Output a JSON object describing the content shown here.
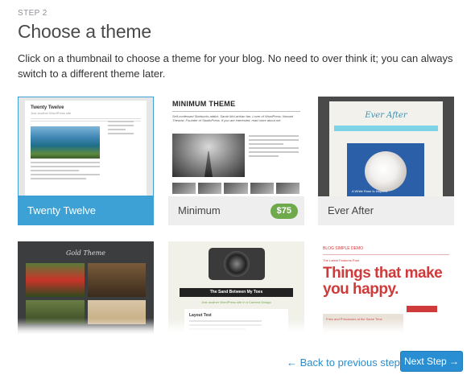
{
  "header": {
    "step": "STEP 2",
    "title": "Choose a theme",
    "description": "Click on a thumbnail to choose a theme for your blog. No need to over think it; you can always switch to a different theme later."
  },
  "themes": [
    {
      "name": "Twenty Twelve",
      "selected": true,
      "price": null,
      "preview_title": "Twenty Twelve",
      "preview_tagline": "Just another WordPress site"
    },
    {
      "name": "Minimum",
      "selected": false,
      "price": "$75",
      "preview_title": "MINIMUM THEME",
      "preview_intro": "Self-confessed Starbucks addict. Sarah McLachlan fan. Lover of WordPress. Nomad Theorist. Founder of StudioPress. If you are interested, read more about me."
    },
    {
      "name": "Ever After",
      "selected": false,
      "price": null,
      "preview_title": "Ever After",
      "preview_caption": "A White Rose Is Inspired"
    },
    {
      "name": "",
      "selected": false,
      "price": null,
      "preview_title": "Gold Theme"
    },
    {
      "name": "",
      "selected": false,
      "price": null,
      "preview_title": "The Sand Between My Toes",
      "preview_subtitle": "Just another WordPress site in a Camera Design",
      "preview_post": "Layout Test"
    },
    {
      "name": "",
      "selected": false,
      "price": null,
      "preview_header": "BLOG SIMPLE DEMO",
      "preview_small": "The Latest Features Post",
      "preview_headline": "Things that make you happy.",
      "preview_box": "Fries and Princesses at the Same Time"
    }
  ],
  "footer": {
    "back_label": "← Back to previous step",
    "next_label": "Next Step →"
  },
  "colors": {
    "accent": "#3da1d6",
    "button": "#2a8fd2",
    "price_badge": "#6ea94c",
    "link": "#2e8bc9"
  }
}
